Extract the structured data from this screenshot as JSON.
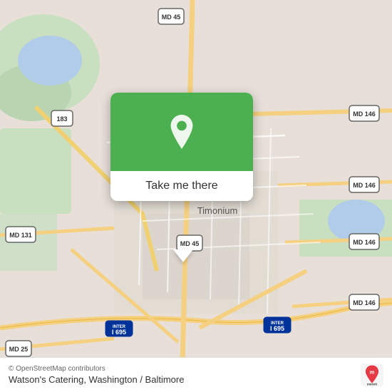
{
  "map": {
    "alt": "Map of Timonium, Baltimore area"
  },
  "popup": {
    "button_label": "Take me there",
    "pin_alt": "Location pin"
  },
  "bottom_bar": {
    "copyright": "© OpenStreetMap contributors",
    "location": "Watson's Catering, Washington / Baltimore"
  },
  "moovit": {
    "logo_alt": "moovit"
  },
  "road_labels": {
    "md45_north": "MD 45",
    "md45_south": "MD 45",
    "md146_1": "MD 146",
    "md146_2": "MD 146",
    "md146_3": "MD 146",
    "md146_4": "MD 146",
    "md131": "MD 131",
    "md25": "MD 25",
    "i183": "183",
    "i695_1": "I 695",
    "i695_2": "I 695",
    "timonium": "Timonium"
  }
}
